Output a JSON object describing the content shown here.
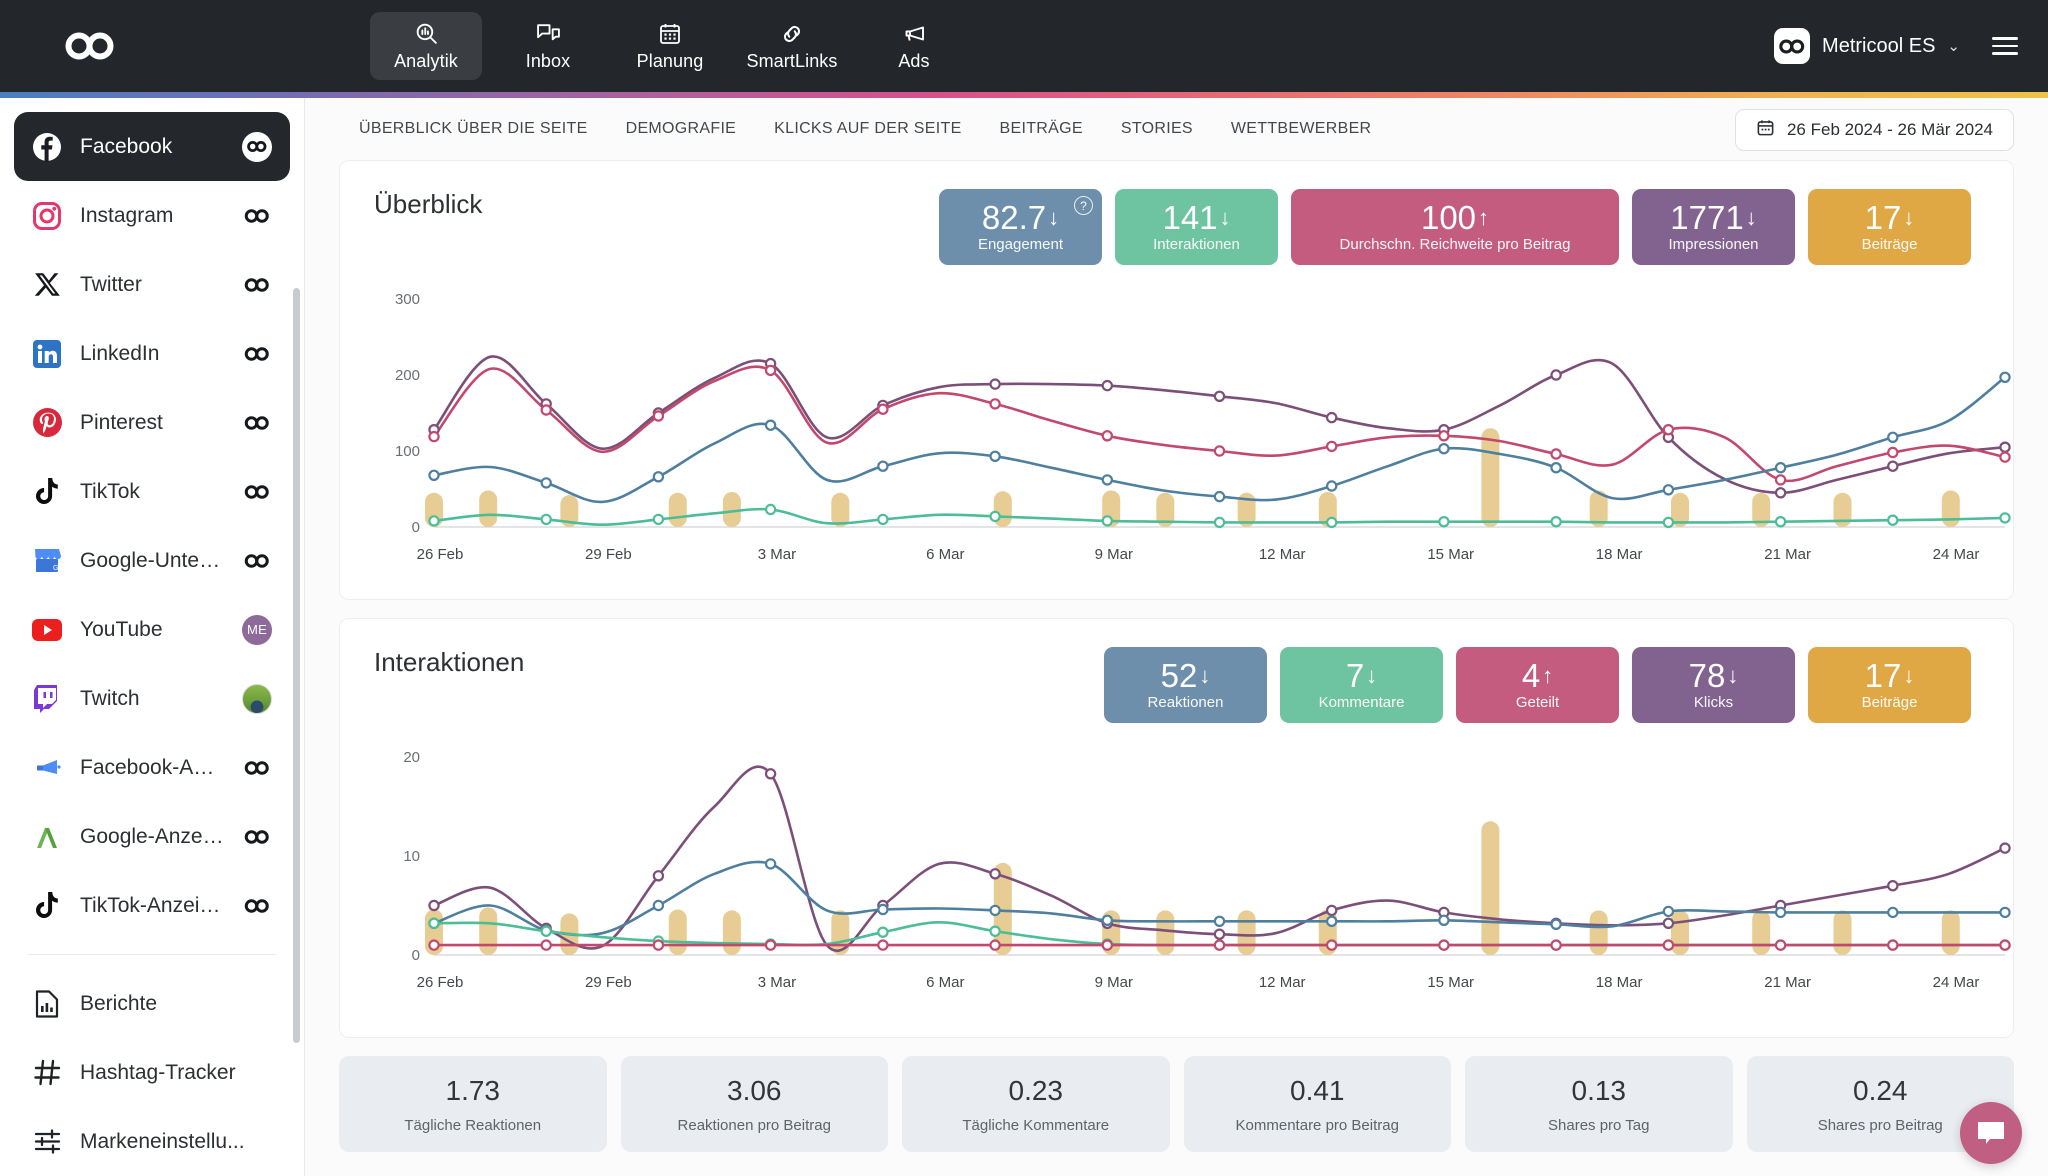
{
  "topnav": {
    "brand_icon": "metricool-infinity-logo",
    "items": [
      {
        "label": "Analytik",
        "icon": "analytics-magnifier-icon",
        "active": true
      },
      {
        "label": "Inbox",
        "icon": "chat-bubbles-icon",
        "active": false
      },
      {
        "label": "Planung",
        "icon": "calendar-icon",
        "active": false
      },
      {
        "label": "SmartLinks",
        "icon": "link-chain-icon",
        "active": false
      },
      {
        "label": "Ads",
        "icon": "megaphone-icon",
        "active": false
      }
    ],
    "account": {
      "name": "Metricool ES",
      "avatar_icon": "metricool-infinity-avatar",
      "chevron_icon": "chevron-down-icon"
    },
    "menu_icon": "hamburger-menu-icon"
  },
  "sidebar": {
    "items": [
      {
        "label": "Facebook",
        "icon": "facebook-icon",
        "badge": "infinity",
        "active": true
      },
      {
        "label": "Instagram",
        "icon": "instagram-icon",
        "badge": "infinity",
        "active": false
      },
      {
        "label": "Twitter",
        "icon": "twitter-x-icon",
        "badge": "infinity",
        "active": false
      },
      {
        "label": "LinkedIn",
        "icon": "linkedin-icon",
        "badge": "infinity",
        "active": false
      },
      {
        "label": "Pinterest",
        "icon": "pinterest-icon",
        "badge": "infinity",
        "active": false
      },
      {
        "label": "TikTok",
        "icon": "tiktok-icon",
        "badge": "infinity",
        "active": false
      },
      {
        "label": "Google-Unterne...",
        "icon": "google-business-icon",
        "badge": "infinity",
        "active": false
      },
      {
        "label": "YouTube",
        "icon": "youtube-icon",
        "badge": "me",
        "badge_text": "ME",
        "active": false
      },
      {
        "label": "Twitch",
        "icon": "twitch-icon",
        "badge": "photo",
        "active": false
      },
      {
        "label": "Facebook-Anzei...",
        "icon": "facebook-ads-icon",
        "badge": "infinity",
        "active": false
      },
      {
        "label": "Google-Anzeigen",
        "icon": "google-ads-icon",
        "badge": "infinity",
        "active": false
      },
      {
        "label": "TikTok-Anzeigen",
        "icon": "tiktok-ads-icon",
        "badge": "infinity",
        "active": false
      }
    ],
    "tools": [
      {
        "label": "Berichte",
        "icon": "reports-icon"
      },
      {
        "label": "Hashtag-Tracker",
        "icon": "hashtag-icon"
      },
      {
        "label": "Markeneinstellu...",
        "icon": "sliders-icon"
      }
    ]
  },
  "tabs": [
    {
      "label": "ÜBERBLICK ÜBER DIE SEITE",
      "active": true
    },
    {
      "label": "DEMOGRAFIE",
      "active": false
    },
    {
      "label": "KLICKS AUF DER SEITE",
      "active": false
    },
    {
      "label": "BEITRÄGE",
      "active": false
    },
    {
      "label": "STORIES",
      "active": false
    },
    {
      "label": "WETTBEWERBER",
      "active": false
    }
  ],
  "daterange": {
    "icon": "calendar-icon",
    "value": "26 Feb 2024 - 26 Mär 2024"
  },
  "overview": {
    "title": "Überblick",
    "kpis": [
      {
        "value": "82.7",
        "arrow": "↓",
        "label": "Engagement",
        "color": "#6d8fab",
        "help": "?",
        "wide": false
      },
      {
        "value": "141",
        "arrow": "↓",
        "label": "Interaktionen",
        "color": "#6ec4a0",
        "wide": false
      },
      {
        "value": "100",
        "arrow": "↑",
        "label": "Durchschn. Reichweite pro Beitrag",
        "color": "#c45c80",
        "wide": true
      },
      {
        "value": "1771",
        "arrow": "↓",
        "label": "Impressionen",
        "color": "#82628f",
        "wide": false
      },
      {
        "value": "17",
        "arrow": "↓",
        "label": "Beiträge",
        "color": "#dfa845",
        "wide": false
      }
    ]
  },
  "interactions": {
    "title": "Interaktionen",
    "kpis": [
      {
        "value": "52",
        "arrow": "↓",
        "label": "Reaktionen",
        "color": "#6d8fab",
        "wide": false
      },
      {
        "value": "7",
        "arrow": "↓",
        "label": "Kommentare",
        "color": "#6ec4a0",
        "wide": false
      },
      {
        "value": "4",
        "arrow": "↑",
        "label": "Geteilt",
        "color": "#c45c80",
        "wide": false
      },
      {
        "value": "78",
        "arrow": "↓",
        "label": "Klicks",
        "color": "#82628f",
        "wide": false
      },
      {
        "value": "17",
        "arrow": "↓",
        "label": "Beiträge",
        "color": "#dfa845",
        "wide": false
      }
    ]
  },
  "statcards": [
    {
      "value": "1.73",
      "label": "Tägliche Reaktionen"
    },
    {
      "value": "3.06",
      "label": "Reaktionen pro Beitrag"
    },
    {
      "value": "0.23",
      "label": "Tägliche Kommentare"
    },
    {
      "value": "0.41",
      "label": "Kommentare pro Beitrag"
    },
    {
      "value": "0.13",
      "label": "Shares pro Tag"
    },
    {
      "value": "0.24",
      "label": "Shares pro Beitrag"
    }
  ],
  "chat_button": {
    "icon": "chat-bubble-icon",
    "color": "#c05f82"
  },
  "colors": {
    "blue": "#4e7f9e",
    "green": "#4cbd94",
    "pink": "#c2486e",
    "purple": "#7c4f78",
    "bar": "#e7cd94",
    "nav_bg": "#23262a",
    "accent_strip": "linear-gradient blue-purple-pink-orange"
  },
  "chart_data": [
    {
      "type": "line",
      "title": "Überblick",
      "xlabel": "",
      "ylabel": "",
      "ylim": [
        0,
        300
      ],
      "yticks": [
        0,
        100,
        200,
        300
      ],
      "grid": false,
      "legend_position": "none",
      "x": [
        "26 Feb",
        "27 Feb",
        "28 Feb",
        "29 Feb",
        "1 Mar",
        "2 Mar",
        "3 Mar",
        "4 Mar",
        "5 Mar",
        "6 Mar",
        "7 Mar",
        "8 Mar",
        "9 Mar",
        "10 Mar",
        "11 Mar",
        "12 Mar",
        "13 Mar",
        "14 Mar",
        "15 Mar",
        "16 Mar",
        "17 Mar",
        "18 Mar",
        "19 Mar",
        "20 Mar",
        "21 Mar",
        "22 Mar",
        "23 Mar",
        "24 Mar",
        "25 Mar"
      ],
      "xtick_labels": [
        "26 Feb",
        "29 Feb",
        "3 Mar",
        "6 Mar",
        "9 Mar",
        "12 Mar",
        "15 Mar",
        "18 Mar",
        "21 Mar",
        "24 Mar"
      ],
      "series": [
        {
          "name": "Impressionen",
          "color": "#7c4f78",
          "values": [
            128,
            224,
            162,
            103,
            150,
            196,
            215,
            118,
            160,
            184,
            188,
            188,
            186,
            180,
            172,
            163,
            144,
            130,
            128,
            160,
            200,
            215,
            118,
            63,
            45,
            62,
            80,
            97,
            105
          ]
        },
        {
          "name": "Reichweite",
          "color": "#c2486e",
          "values": [
            119,
            208,
            154,
            99,
            146,
            192,
            206,
            111,
            155,
            176,
            162,
            140,
            120,
            108,
            100,
            94,
            106,
            118,
            120,
            113,
            96,
            82,
            128,
            118,
            62,
            80,
            98,
            107,
            92
          ]
        },
        {
          "name": "Engagement",
          "color": "#4e7f9e",
          "values": [
            68,
            79,
            58,
            33,
            66,
            110,
            134,
            62,
            80,
            97,
            93,
            78,
            62,
            48,
            40,
            36,
            54,
            80,
            103,
            96,
            78,
            38,
            49,
            62,
            78,
            95,
            118,
            140,
            197
          ]
        },
        {
          "name": "Interaktionen",
          "color": "#4cbd94",
          "values": [
            8,
            16,
            10,
            3,
            10,
            18,
            23,
            5,
            10,
            16,
            14,
            11,
            8,
            7,
            6,
            6,
            6,
            7,
            7,
            7,
            7,
            6,
            6,
            6,
            7,
            8,
            9,
            10,
            12
          ]
        }
      ],
      "bars": {
        "name": "Beiträge",
        "color": "#e7cd94",
        "x_index": [
          0,
          2,
          5,
          9,
          11,
          15,
          21,
          25,
          27,
          30,
          33,
          39,
          43,
          46,
          49,
          52,
          56
        ],
        "values": [
          45,
          48,
          42,
          45,
          46,
          45,
          47,
          48,
          45,
          45,
          46,
          130,
          48,
          45,
          45,
          45,
          48
        ]
      }
    },
    {
      "type": "line",
      "title": "Interaktionen",
      "xlabel": "",
      "ylabel": "",
      "ylim": [
        0,
        20
      ],
      "yticks": [
        0,
        10,
        20
      ],
      "grid": false,
      "legend_position": "none",
      "x": [
        "26 Feb",
        "27 Feb",
        "28 Feb",
        "29 Feb",
        "1 Mar",
        "2 Mar",
        "3 Mar",
        "4 Mar",
        "5 Mar",
        "6 Mar",
        "7 Mar",
        "8 Mar",
        "9 Mar",
        "10 Mar",
        "11 Mar",
        "12 Mar",
        "13 Mar",
        "14 Mar",
        "15 Mar",
        "16 Mar",
        "17 Mar",
        "18 Mar",
        "19 Mar",
        "20 Mar",
        "21 Mar",
        "22 Mar",
        "23 Mar",
        "24 Mar",
        "25 Mar"
      ],
      "xtick_labels": [
        "26 Feb",
        "29 Feb",
        "3 Mar",
        "6 Mar",
        "9 Mar",
        "12 Mar",
        "15 Mar",
        "18 Mar",
        "21 Mar",
        "24 Mar"
      ],
      "series": [
        {
          "name": "Klicks",
          "color": "#7c4f78",
          "values": [
            5.0,
            6.8,
            2.7,
            0.9,
            8.0,
            15.0,
            18.3,
            1.0,
            5.0,
            9.2,
            8.2,
            6.0,
            3.2,
            2.5,
            2.1,
            2.2,
            4.5,
            5.5,
            4.3,
            3.6,
            3.2,
            3.0,
            3.2,
            4.0,
            5.0,
            6.0,
            7.0,
            8.2,
            10.8
          ]
        },
        {
          "name": "Reaktionen",
          "color": "#4e7f9e",
          "values": [
            3.2,
            5.0,
            2.5,
            2.2,
            5.0,
            8.2,
            9.2,
            4.5,
            4.6,
            4.7,
            4.5,
            4.2,
            3.5,
            3.4,
            3.4,
            3.4,
            3.4,
            3.4,
            3.5,
            3.3,
            3.1,
            2.9,
            4.4,
            4.4,
            4.3,
            4.3,
            4.3,
            4.3,
            4.3
          ]
        },
        {
          "name": "Kommentare",
          "color": "#4cbd94",
          "values": [
            3.2,
            3.2,
            2.4,
            1.8,
            1.4,
            1.2,
            1.1,
            1.1,
            2.3,
            3.3,
            2.4,
            1.6,
            1.1,
            1.0,
            1.0,
            1.0,
            1.0,
            1.0,
            1.0,
            1.0,
            1.0,
            1.0,
            1.0,
            1.0,
            1.0,
            1.0,
            1.0,
            1.0,
            1.0
          ]
        },
        {
          "name": "Geteilt",
          "color": "#c2486e",
          "values": [
            1.0,
            1.0,
            1.0,
            1.0,
            1.0,
            1.0,
            1.0,
            1.0,
            1.0,
            1.0,
            1.0,
            1.0,
            1.0,
            1.0,
            1.0,
            1.0,
            1.0,
            1.0,
            1.0,
            1.0,
            1.0,
            1.0,
            1.0,
            1.0,
            1.0,
            1.0,
            1.0,
            1.0,
            1.0
          ]
        }
      ],
      "bars": {
        "name": "Beiträge",
        "color": "#e7cd94",
        "x_index": [
          0,
          2,
          5,
          9,
          11,
          15,
          21,
          25,
          27,
          30,
          33,
          39,
          43,
          46,
          49,
          52,
          56
        ],
        "values": [
          4.6,
          4.8,
          4.2,
          4.6,
          4.5,
          4.5,
          9.3,
          4.5,
          4.5,
          4.5,
          4.6,
          13.5,
          4.5,
          4.5,
          4.5,
          4.5,
          4.5
        ]
      }
    }
  ]
}
